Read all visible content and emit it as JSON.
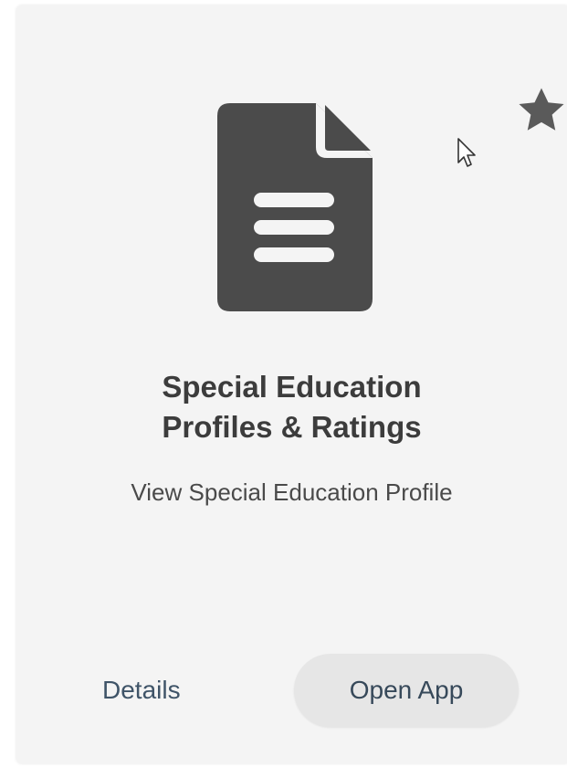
{
  "card": {
    "title_line1": "Special Education",
    "title_line2": "Profiles & Ratings",
    "subtitle": "View Special Education Profile",
    "details_label": "Details",
    "open_app_label": "Open App",
    "icon": "document-icon",
    "favorite_icon": "star-icon"
  },
  "colors": {
    "card_background": "#f4f4f4",
    "icon": "#4b4b4b",
    "title_text": "#3c3c3c",
    "link_text": "#3f5468",
    "button_background": "#e6e6e6"
  }
}
